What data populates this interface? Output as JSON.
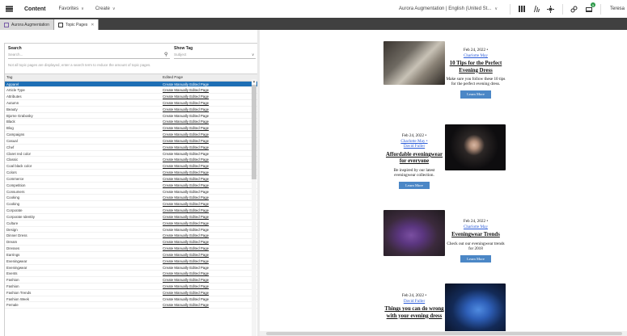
{
  "topbar": {
    "app_name": "Content",
    "menus": [
      "Favorites",
      "Create"
    ],
    "site": "Aurora Augmentation | English (United St...",
    "user": "Teresa",
    "notification_count": "5"
  },
  "tabs": [
    {
      "label": "Aurora Augmentation",
      "active": false
    },
    {
      "label": "Topic Pages",
      "active": true
    }
  ],
  "filters": {
    "search_label": "Search",
    "search_placeholder": "Search...",
    "showtag_label": "Show Tag",
    "showtag_placeholder": "Subject",
    "hint": "Not all topic pages are displayed, enter a search term to reduce the amount of topic pages."
  },
  "grid": {
    "columns": [
      "Tag",
      "Edited Page"
    ],
    "action_label": "Create Manually Edited Page",
    "rows": [
      "Apparel",
      "Article Type",
      "Attributes",
      "Autumn",
      "Beauty",
      "Bjorne Grabosky",
      "Black",
      "Blog",
      "Campaigns",
      "Casual",
      "Chef",
      "Claret red color",
      "Classic",
      "Coal black color",
      "Colors",
      "Commerce",
      "Competition",
      "Consumers",
      "Cooking",
      "Cooking",
      "Corporate",
      "Corporate Identity",
      "Culture",
      "Design",
      "Dinner Dress",
      "Dream",
      "Dresses",
      "Earrings",
      "Eveningwear",
      "Eveningwear",
      "Events",
      "Fashion",
      "Fashion",
      "Fashion Trends",
      "Fashion Week",
      "Female"
    ],
    "selected_index": 0
  },
  "preview": {
    "cards": [
      {
        "date": "Feb 24, 2022 •",
        "authors": [
          "Charlotte May"
        ],
        "title": "10 Tips for the Perfect Evening Dress",
        "desc": "Make sure you follow these 10 tips for the perfect evening dress.",
        "button": "Learn More"
      },
      {
        "date": "Feb 24, 2022 •",
        "authors": [
          "Charlotte May •",
          "David Fuller"
        ],
        "title": "Affordable eveningwear for everyone",
        "desc": "Be inspired by our latest eveningwear collection.",
        "button": "Learn More"
      },
      {
        "date": "Feb 24, 2022 •",
        "authors": [
          "Charlotte May"
        ],
        "title": "Eveningwear Trends",
        "desc": "Check out our eveningwear trends for 2018",
        "button": "Learn More"
      },
      {
        "date": "Feb 24, 2022 •",
        "authors": [
          "David Fuller"
        ],
        "title": "Things you can do wrong with your evening dress",
        "desc": "",
        "button": ""
      }
    ]
  }
}
